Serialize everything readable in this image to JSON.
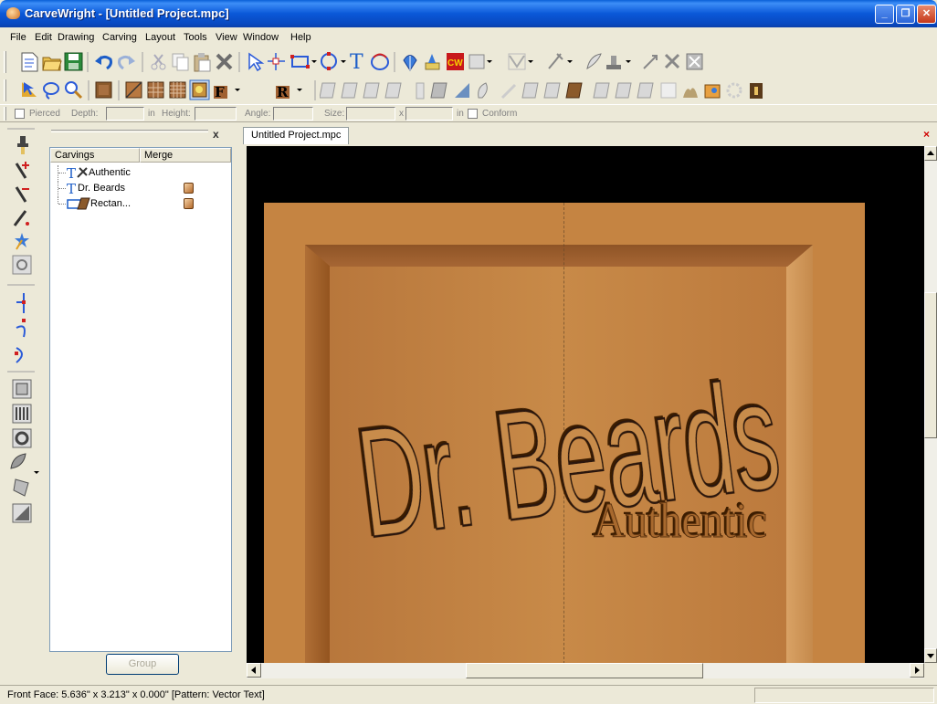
{
  "window": {
    "title": "CarveWright - [Untitled Project.mpc]",
    "minimize": "_",
    "restore": "❐",
    "close": "✕"
  },
  "menu": [
    "File",
    "Edit",
    "Drawing",
    "Carving",
    "Layout",
    "Tools",
    "View",
    "Window",
    "Help"
  ],
  "props": {
    "pierced": "Pierced",
    "depth": "Depth:",
    "in1": "in",
    "height": "Height:",
    "angle": "Angle:",
    "size": "Size:",
    "x": "x",
    "in2": "in",
    "conform": "Conform"
  },
  "panel": {
    "close": "x",
    "col_carvings": "Carvings",
    "col_merge": "Merge",
    "group_button": "Group",
    "items": [
      {
        "label": "Authentic",
        "icon": "text-icon"
      },
      {
        "label": "Dr. Beards",
        "icon": "text-icon"
      },
      {
        "label": "Rectan...",
        "icon": "rectangle-icon"
      }
    ]
  },
  "document": {
    "tab": "Untitled Project.mpc",
    "close": "×",
    "carving_main": "Dr. Beards",
    "carving_sub": "Authentic"
  },
  "status": {
    "text": "Front Face: 5.636\" x 3.213\" x 0.000\"  [Pattern: Vector Text]"
  },
  "colors": {
    "board": "#c58442",
    "titlebar": "#0a5fd8"
  }
}
